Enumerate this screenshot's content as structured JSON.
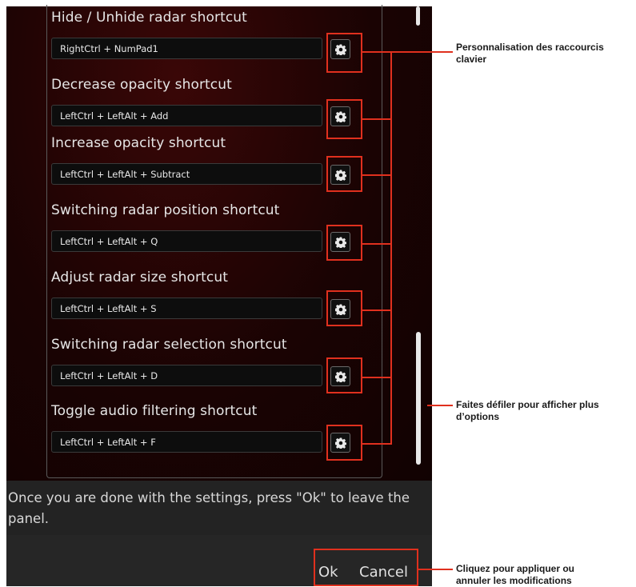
{
  "shortcuts": [
    {
      "label": "Hide / Unhide radar shortcut",
      "value": "RightCtrl + NumPad1"
    },
    {
      "label": "Decrease opacity shortcut",
      "value": "LeftCtrl + LeftAlt + Add"
    },
    {
      "label": "Increase opacity shortcut",
      "value": "LeftCtrl + LeftAlt + Subtract"
    },
    {
      "label": "Switching radar position shortcut",
      "value": "LeftCtrl + LeftAlt + Q"
    },
    {
      "label": "Adjust radar size shortcut",
      "value": "LeftCtrl + LeftAlt + S"
    },
    {
      "label": "Switching radar selection shortcut",
      "value": "LeftCtrl + LeftAlt + D"
    },
    {
      "label": "Toggle audio filtering shortcut",
      "value": "LeftCtrl + LeftAlt + F"
    }
  ],
  "message": {
    "line1": "Once you are done with the settings, press \"Ok\" to leave the",
    "line2": "panel."
  },
  "buttons": {
    "ok": "Ok",
    "cancel": "Cancel"
  },
  "annotations": {
    "customize_line1": "Personnalisation des raccourcis",
    "customize_line2": "clavier",
    "scroll_line1": "Faites défiler pour afficher plus",
    "scroll_line2": "d’options",
    "apply_line1": "Cliquez pour appliquer ou",
    "apply_line2": "annuler les modifications"
  },
  "colors": {
    "accent": "#e0301e",
    "panel": "#1a0303"
  },
  "icons": {
    "settings": "gear-icon"
  }
}
